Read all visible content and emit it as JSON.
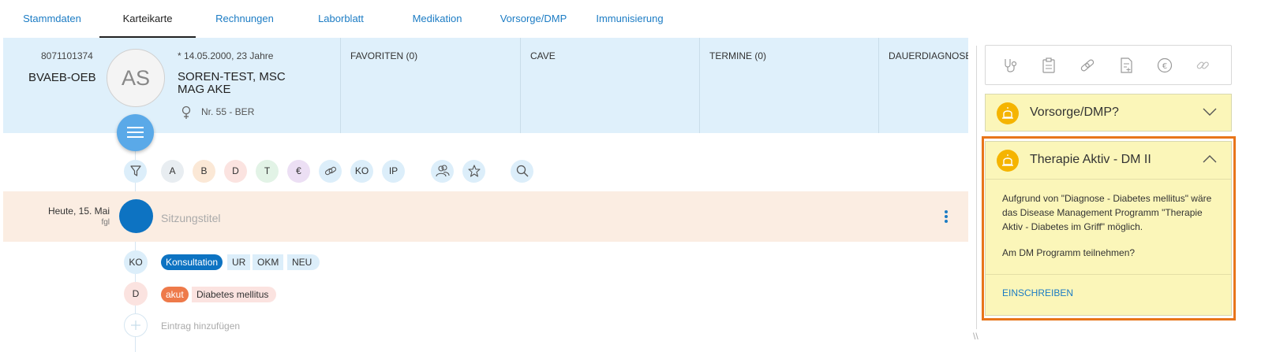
{
  "tabs": [
    {
      "label": "Stammdaten"
    },
    {
      "label": "Karteikarte",
      "active": true
    },
    {
      "label": "Rechnungen"
    },
    {
      "label": "Laborblatt"
    },
    {
      "label": "Medikation"
    },
    {
      "label": "Vorsorge/DMP"
    },
    {
      "label": "Immunisierung"
    }
  ],
  "patient": {
    "id": "8071101374",
    "insurance": "BVAEB-OEB",
    "initials": "AS",
    "birth": "* 14.05.2000, 23 Jahre",
    "name": "SOREN-TEST, MSC MAG AKE",
    "room": "Nr. 55 - BER"
  },
  "header_columns": [
    {
      "label": "FAVORITEN (0)"
    },
    {
      "label": "CAVE"
    },
    {
      "label": "TERMINE (0)"
    },
    {
      "label": "DAUERDIAGNOSEN"
    }
  ],
  "filters": [
    {
      "label": "A",
      "color": "#e8edf1"
    },
    {
      "label": "B",
      "color": "#fbe8d6"
    },
    {
      "label": "D",
      "color": "#fbe3e0"
    },
    {
      "label": "T",
      "color": "#e2f3e6"
    },
    {
      "label": "€",
      "color": "#ecdff4"
    },
    {
      "label": "",
      "icon": "link-icon",
      "color": "#dceefa"
    },
    {
      "label": "KO",
      "color": "#dceefa"
    },
    {
      "label": "IP",
      "color": "#dceefa"
    }
  ],
  "session": {
    "date": "Heute, 15. Mai",
    "user": "fgl",
    "title_placeholder": "Sitzungstitel"
  },
  "entries": {
    "ko": {
      "code": "KO",
      "chips": [
        "Konsultation",
        "UR",
        "OKM",
        "NEU"
      ]
    },
    "d": {
      "code": "D",
      "chips": [
        "akut",
        "Diabetes mellitus"
      ]
    },
    "add_label": "Eintrag hinzufügen"
  },
  "right_panel": {
    "card1_title": "Vorsorge/DMP?",
    "card2_title": "Therapie Aktiv - DM II",
    "card2_text": "Aufgrund von \"Diagnose - Diabetes mellitus\" wäre das Disease Management Programm \"Therapie Aktiv - Diabetes im Griff\" möglich.",
    "card2_question": "Am DM Programm teilnehmen?",
    "card2_action": "EINSCHREIBEN"
  },
  "colors": {
    "accent": "#1c7cc4",
    "header_bg": "#dff0fb",
    "session_bg": "#fbede2",
    "alert_bg": "#fbf6b9",
    "highlight": "#e8751a"
  }
}
